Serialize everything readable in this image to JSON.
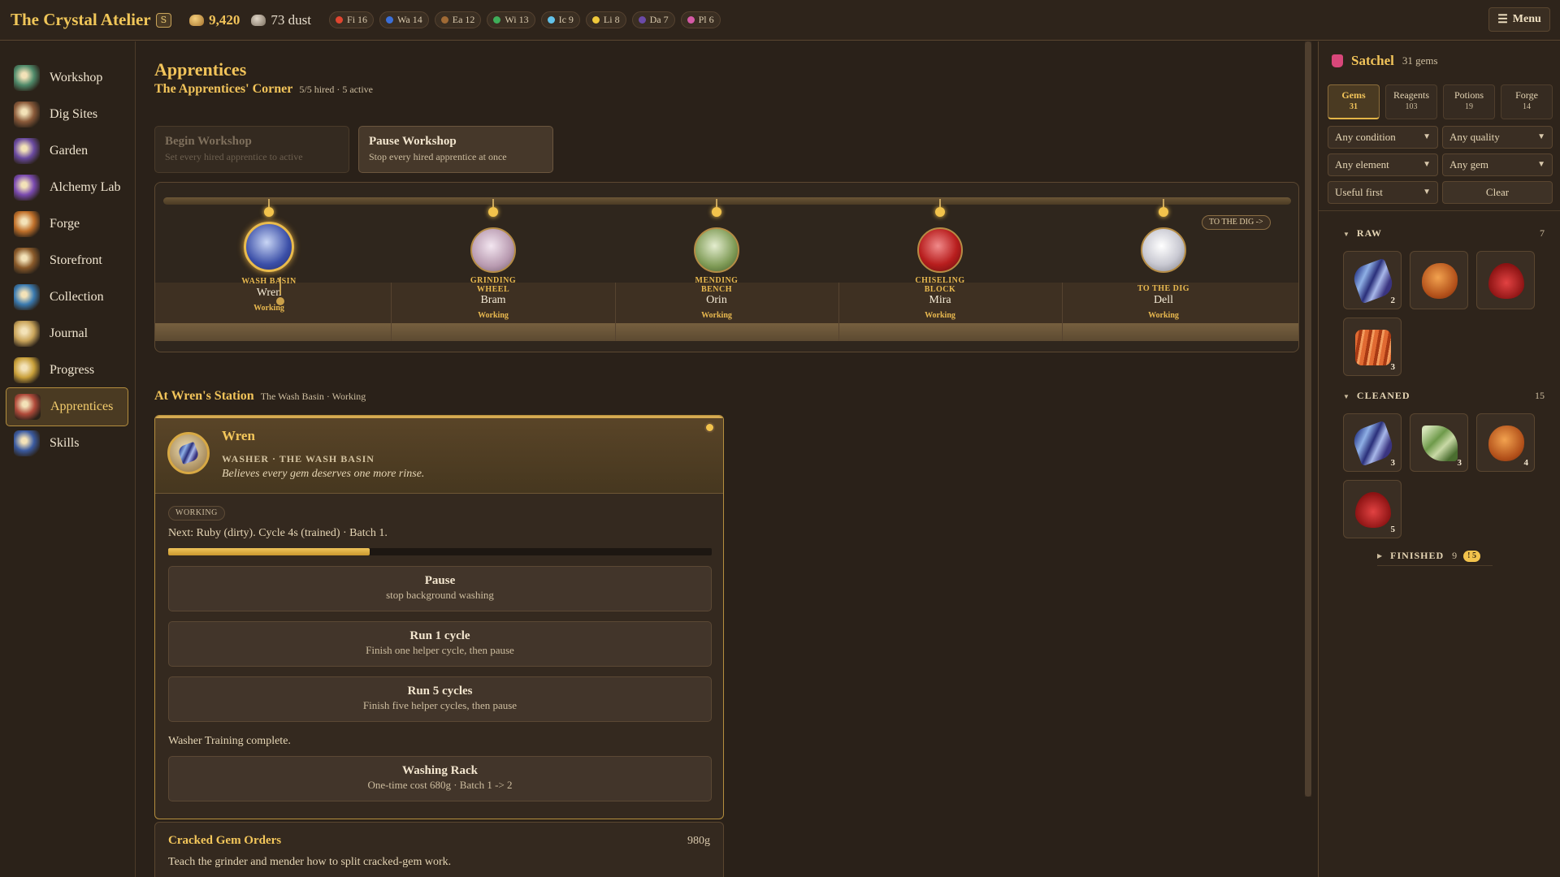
{
  "app": {
    "title": "The Crystal Atelier",
    "badge": "S"
  },
  "currency": {
    "gold": "9,420",
    "dust": "73 dust"
  },
  "elements": [
    {
      "label": "Fi 16",
      "color": "#e0452f"
    },
    {
      "label": "Wa 14",
      "color": "#3b6fd8"
    },
    {
      "label": "Ea 12",
      "color": "#a06a35"
    },
    {
      "label": "Wi 13",
      "color": "#3fae5a"
    },
    {
      "label": "Ic 9",
      "color": "#63c3ea"
    },
    {
      "label": "Li 8",
      "color": "#f0c93b"
    },
    {
      "label": "Da 7",
      "color": "#6b4aa8"
    },
    {
      "label": "Pl 6",
      "color": "#d55aa6"
    }
  ],
  "menu": {
    "label": "Menu"
  },
  "nav": [
    {
      "label": "Workshop",
      "icon": "workshop-icon",
      "color": "#4f8a6a"
    },
    {
      "label": "Dig Sites",
      "icon": "dig-sites-icon",
      "color": "#8a5a3a"
    },
    {
      "label": "Garden",
      "icon": "garden-icon",
      "color": "#6a4aa0"
    },
    {
      "label": "Alchemy Lab",
      "icon": "alchemy-lab-icon",
      "color": "#7a4ab0"
    },
    {
      "label": "Forge",
      "icon": "forge-icon",
      "color": "#c0702a"
    },
    {
      "label": "Storefront",
      "icon": "storefront-icon",
      "color": "#8a5a2a"
    },
    {
      "label": "Collection",
      "icon": "collection-icon",
      "color": "#3a7ab0"
    },
    {
      "label": "Journal",
      "icon": "journal-icon",
      "color": "#c9a45a"
    },
    {
      "label": "Progress",
      "icon": "progress-icon",
      "color": "#c9a03a"
    },
    {
      "label": "Apprentices",
      "icon": "apprentices-icon",
      "color": "#b04a3a"
    },
    {
      "label": "Skills",
      "icon": "skills-icon",
      "color": "#3a5aa0"
    }
  ],
  "page": {
    "title": "Apprentices",
    "corner_title": "The Apprentices' Corner",
    "corner_sub": "5/5 hired · 5 active",
    "begin": {
      "title": "Begin Workshop",
      "sub": "Set every hired apprentice to active"
    },
    "pause": {
      "title": "Pause Workshop",
      "sub": "Stop every hired apprentice at once"
    },
    "to_dig_tag": "TO THE DIG ->",
    "stations": [
      {
        "label": "WASH BASIN",
        "name": "Wren",
        "status": "Working",
        "gem": "sapphire"
      },
      {
        "label": "GRINDING WHEEL",
        "name": "Bram",
        "status": "Working",
        "gem": "pearl"
      },
      {
        "label": "MENDING BENCH",
        "name": "Orin",
        "status": "Working",
        "gem": "leaf"
      },
      {
        "label": "CHISELING BLOCK",
        "name": "Mira",
        "status": "Working",
        "gem": "ruby"
      },
      {
        "label": "TO THE DIG",
        "name": "Dell",
        "status": "Working",
        "gem": "quartz"
      }
    ],
    "station_title": "At Wren's Station",
    "station_sub": "The Wash Basin · Working"
  },
  "wren": {
    "name": "Wren",
    "role": "WASHER · THE WASH BASIN",
    "desc": "Believes every gem deserves one more rinse.",
    "status": "WORKING",
    "next": "Next: Ruby (dirty). Cycle 4s (trained) · Batch 1.",
    "progress": 0.37,
    "actions": [
      {
        "title": "Pause",
        "sub": "stop background washing"
      },
      {
        "title": "Run 1 cycle",
        "sub": "Finish one helper cycle, then pause"
      },
      {
        "title": "Run 5 cycles",
        "sub": "Finish five helper cycles, then pause"
      }
    ],
    "training": "Washer Training complete.",
    "upgrade": {
      "title": "Washing Rack",
      "sub": "One-time cost 680g · Batch 1 -> 2"
    }
  },
  "orders": {
    "title": "Cracked Gem Orders",
    "price": "980g",
    "desc": "Teach the grinder and mender how to split cracked-gem work."
  },
  "satchel": {
    "title": "Satchel",
    "count": "31 gems",
    "tabs": [
      {
        "label": "Gems",
        "count": "31"
      },
      {
        "label": "Reagents",
        "count": "103"
      },
      {
        "label": "Potions",
        "count": "19"
      },
      {
        "label": "Forge",
        "count": "14"
      }
    ],
    "filters": {
      "condition": "Any condition",
      "quality": "Any quality",
      "element": "Any element",
      "gem": "Any gem",
      "sort": "Useful first",
      "clear": "Clear"
    },
    "raw": {
      "label": "RAW",
      "count": "7",
      "items": [
        {
          "gem": "sapphire",
          "qty": "2"
        },
        {
          "gem": "amber",
          "qty": ""
        },
        {
          "gem": "ruby",
          "qty": ""
        },
        {
          "gem": "rough",
          "qty": "3"
        }
      ]
    },
    "cleaned": {
      "label": "CLEANED",
      "count": "15",
      "items": [
        {
          "gem": "sapphire",
          "qty": "3"
        },
        {
          "gem": "leaf",
          "qty": "3"
        },
        {
          "gem": "amber",
          "qty": "4"
        },
        {
          "gem": "ruby",
          "qty": "5"
        }
      ]
    },
    "finished": {
      "label": "FINISHED",
      "count": "9",
      "warn": "! 5"
    }
  }
}
